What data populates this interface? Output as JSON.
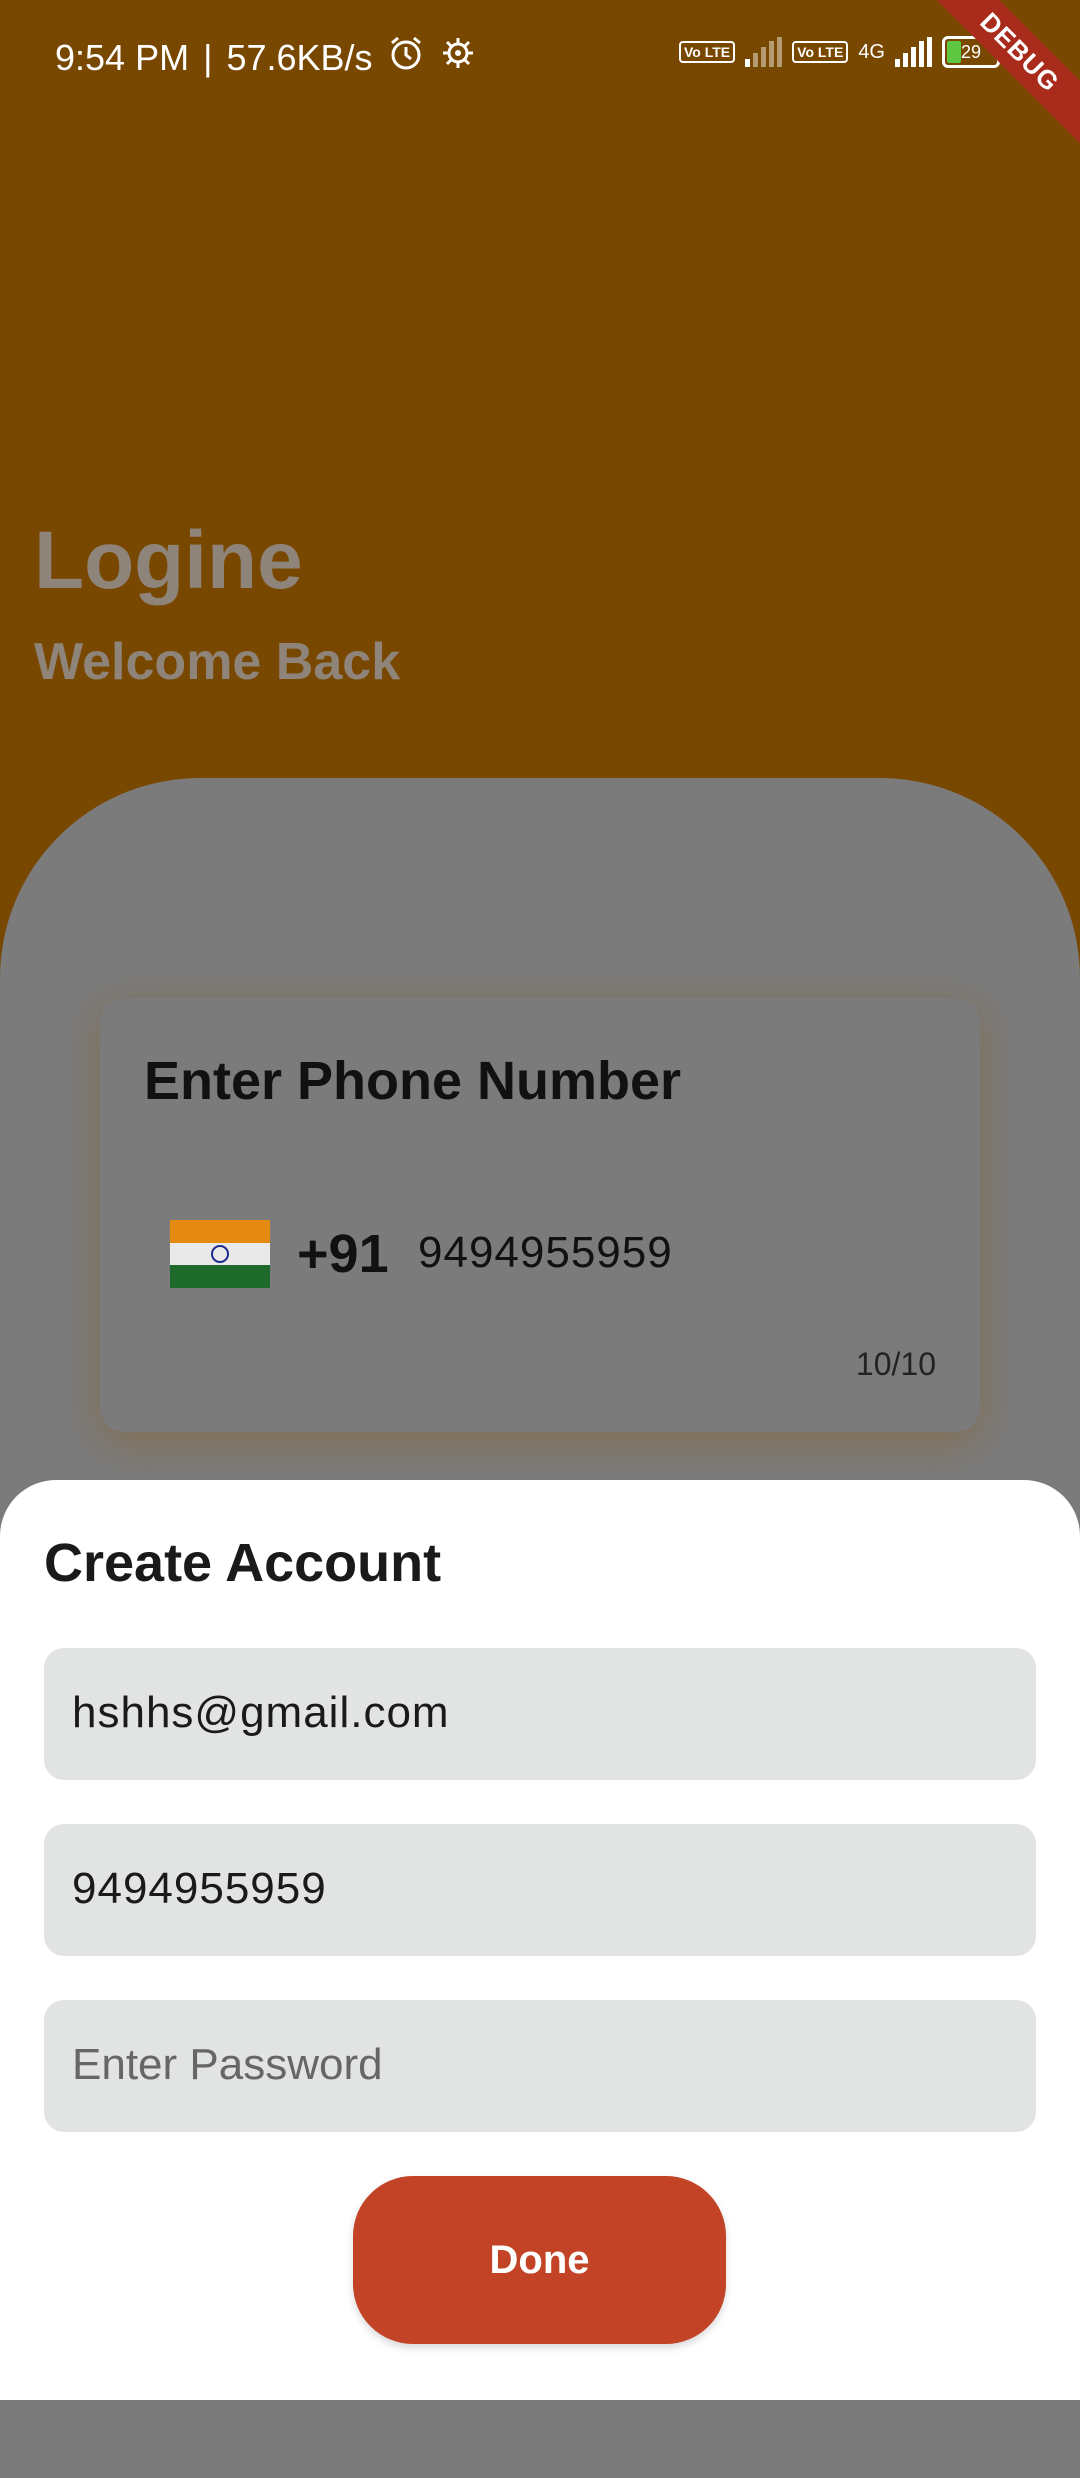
{
  "status_bar": {
    "time": "9:54 PM",
    "speed": "57.6KB/s",
    "network": "4G",
    "battery": "29",
    "volte_label": "Vo LTE"
  },
  "debug_banner": "DEBUG",
  "header": {
    "title": "Logine",
    "subtitle": "Welcome Back"
  },
  "phone_card": {
    "title": "Enter Phone Number",
    "country_code": "+91",
    "phone": "9494955959",
    "counter": "10/10"
  },
  "create_account": {
    "title": "Create Account",
    "email_value": "hshhs@gmail.com",
    "phone_value": "9494955959",
    "password_placeholder": "Enter Password",
    "done_label": "Done"
  },
  "colors": {
    "header_bg": "#794800",
    "button": "#c24326",
    "field_bg": "#e2e3e3"
  }
}
